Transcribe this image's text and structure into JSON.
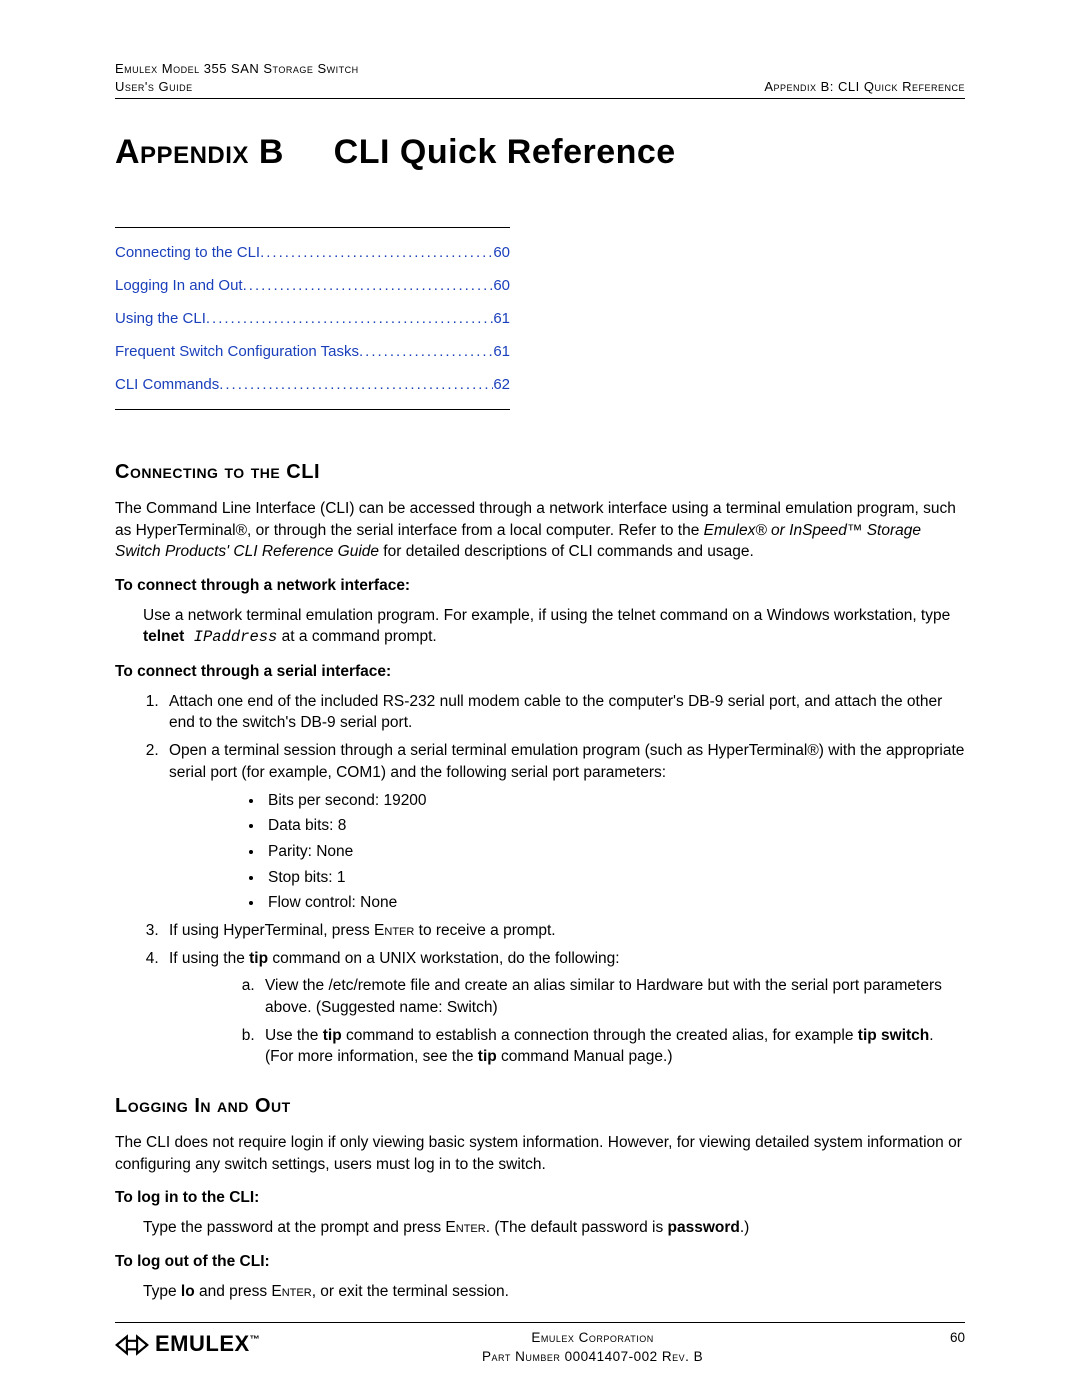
{
  "header": {
    "left_line1": "Emulex Model 355 SAN Storage Switch",
    "left_line2": "User's Guide",
    "right_line2": "Appendix B: CLI Quick Reference"
  },
  "title": {
    "appendix": "Appendix B",
    "rest": "CLI Quick Reference"
  },
  "toc": [
    {
      "label": "Connecting to the CLI",
      "page": "60"
    },
    {
      "label": "Logging In and Out",
      "page": "60"
    },
    {
      "label": "Using the CLI",
      "page": "61"
    },
    {
      "label": "Frequent Switch Configuration Tasks",
      "page": "61"
    },
    {
      "label": "CLI Commands",
      "page": "62"
    }
  ],
  "section1": {
    "heading": "Connecting to the CLI",
    "intro_a": "The Command Line Interface (CLI) can be accessed through a network interface using a terminal emulation program, such as HyperTerminal®, or through the serial interface from a local computer. Refer to the ",
    "intro_ital": "Emulex® or InSpeed™ Storage Switch Products' CLI Reference Guide",
    "intro_b": " for detailed descriptions of CLI commands and usage.",
    "net_heading": "To connect through a network interface:",
    "net_body_a": "Use a network terminal emulation program. For example, if using the telnet command on a Windows workstation, type ",
    "net_body_bold": "telnet",
    "net_body_mono": " IPaddress",
    "net_body_b": " at a command prompt.",
    "serial_heading": "To connect through a serial interface:",
    "step1": "Attach one end of the included RS-232 null modem cable to the computer's DB-9 serial port, and attach the other end to the switch's DB-9 serial port.",
    "step2": "Open a terminal session through a serial terminal emulation program (such as HyperTerminal®) with the appropriate serial port (for example, COM1) and the following serial port parameters:",
    "params": [
      "Bits per second: 19200",
      "Data bits: 8",
      "Parity: None",
      "Stop bits: 1",
      "Flow control: None"
    ],
    "step3_a": "If using HyperTerminal, press ",
    "step3_sc": "Enter",
    "step3_b": " to receive a prompt.",
    "step4_a": "If using the ",
    "step4_bold": "tip",
    "step4_b": " command on a UNIX workstation, do the following:",
    "sub_a": "View the /etc/remote file and create an alias similar to Hardware but with the serial port parameters above. (Suggested name: Switch)",
    "sub_b_a": "Use the ",
    "sub_b_bold1": "tip",
    "sub_b_b": " command to establish a connection through the created alias, for example ",
    "sub_b_bold2": "tip switch",
    "sub_b_c": ". (For more information, see the ",
    "sub_b_bold3": "tip",
    "sub_b_d": " command Manual page.)"
  },
  "section2": {
    "heading": "Logging In and Out",
    "intro": "The CLI does not require login if only viewing basic system information. However, for viewing detailed system information or configuring any switch settings, users must log in to the switch.",
    "login_heading": "To log in to the CLI:",
    "login_a": "Type the password at the prompt and press ",
    "login_sc": "Enter",
    "login_b": ". (The default password is ",
    "login_bold": "password",
    "login_c": ".)",
    "logout_heading": "To log out of the CLI:",
    "logout_a": "Type ",
    "logout_bold": "lo",
    "logout_b": " and press ",
    "logout_sc": "Enter",
    "logout_c": ", or exit the terminal session."
  },
  "footer": {
    "logo_text": "EMULEX",
    "tm": "™",
    "center_line1": "Emulex Corporation",
    "center_line2": "Part Number 00041407-002 Rev. B",
    "page_num": "60"
  }
}
